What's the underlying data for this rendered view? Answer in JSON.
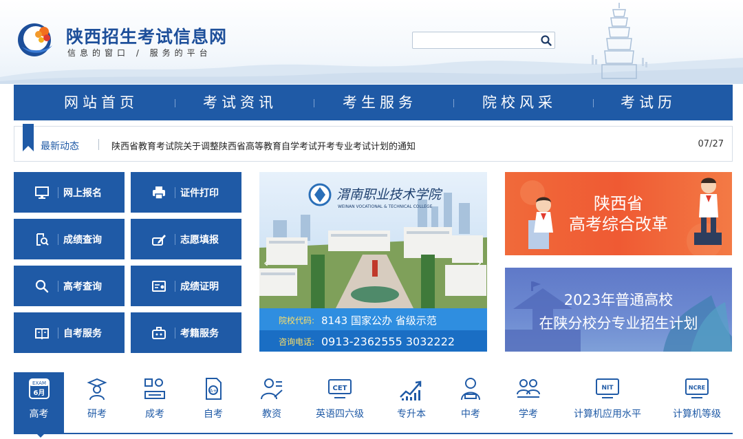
{
  "site": {
    "title": "陕西招生考试信息网",
    "slogan": "信息的窗口 / 服务的平台"
  },
  "search": {
    "placeholder": "",
    "icon": "search-icon"
  },
  "nav": {
    "items": [
      {
        "label": "网站首页"
      },
      {
        "label": "考试资讯"
      },
      {
        "label": "考生服务"
      },
      {
        "label": "院校风采"
      },
      {
        "label": "考试历"
      }
    ]
  },
  "news": {
    "label": "最新动态",
    "headline": "陕西省教育考试院关于调整陕西省高等教育自学考试开考专业考试计划的通知",
    "date": "07/27"
  },
  "services": [
    {
      "label": "网上报名",
      "icon": "monitor-icon"
    },
    {
      "label": "证件打印",
      "icon": "printer-icon"
    },
    {
      "label": "成绩查询",
      "icon": "score-search-icon"
    },
    {
      "label": "志愿填报",
      "icon": "pen-form-icon"
    },
    {
      "label": "高考查询",
      "icon": "search-icon"
    },
    {
      "label": "成绩证明",
      "icon": "certificate-icon"
    },
    {
      "label": "自考服务",
      "icon": "book-icon"
    },
    {
      "label": "考籍服务",
      "icon": "briefcase-icon"
    }
  ],
  "banners": {
    "college": {
      "name": "渭南职业技术学院",
      "name_en": "WEINAN VOCATIONAL & TECHNICAL COLLEGE",
      "code_label": "院校代码:",
      "code_value": "8143  国家公办  省级示范",
      "phone_label": "咨询电话:",
      "phone_value": "0913-2362555  3032222"
    },
    "reform": {
      "line1": "陕西省",
      "line2": "高考综合改革"
    },
    "plan": {
      "line1": "2023年普通高校",
      "line2": "在陕分校分专业招生计划"
    }
  },
  "categories": [
    {
      "label": "高考",
      "icon": "calendar-exam-icon",
      "badge_top": "EXAM",
      "badge_bottom": "6月",
      "active": true
    },
    {
      "label": "研考",
      "icon": "graduate-icon"
    },
    {
      "label": "成考",
      "icon": "adult-exam-icon"
    },
    {
      "label": "自考",
      "icon": "document-icon"
    },
    {
      "label": "教资",
      "icon": "teacher-icon"
    },
    {
      "label": "英语四六级",
      "icon": "cet-icon",
      "badge": "CET"
    },
    {
      "label": "专升本",
      "icon": "growth-chart-icon"
    },
    {
      "label": "中考",
      "icon": "student-icon"
    },
    {
      "label": "学考",
      "icon": "study-group-icon"
    },
    {
      "label": "计算机应用水平",
      "icon": "nit-icon",
      "badge": "NIT"
    },
    {
      "label": "计算机等级",
      "icon": "ncre-icon",
      "badge": "NCRE"
    }
  ],
  "colors": {
    "primary": "#1f5aa6",
    "reform_bg": "#ef5a33",
    "plan_bg": "#6e8bd2"
  }
}
